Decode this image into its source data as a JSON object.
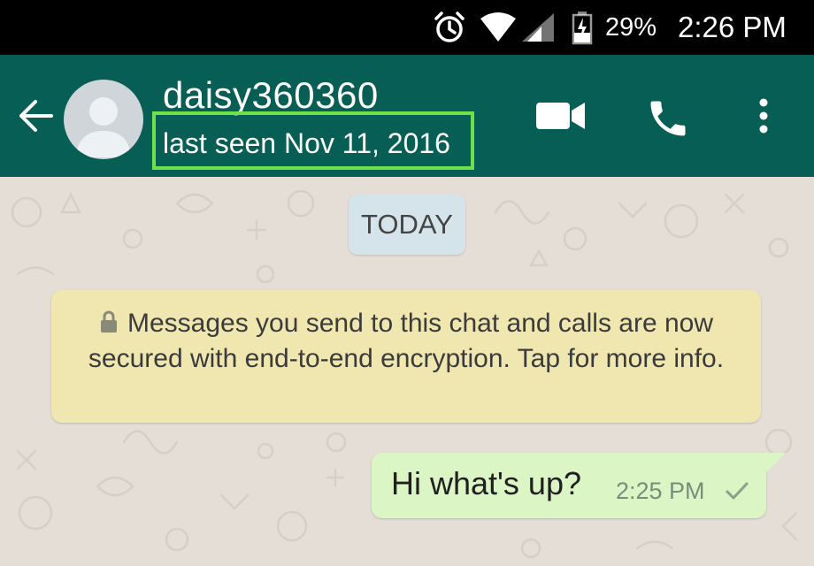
{
  "status_bar": {
    "battery_percent": "29%",
    "time": "2:26 PM",
    "icons": [
      "alarm-icon",
      "wifi-icon",
      "signal-icon",
      "battery-icon"
    ]
  },
  "header": {
    "contact_name": "daisy360360",
    "last_seen": "last seen Nov 11, 2016",
    "highlight_color": "#6ee04a",
    "background_color": "#075e54",
    "icons": [
      "back-arrow-icon",
      "avatar",
      "video-call-icon",
      "phone-icon",
      "more-options-icon"
    ]
  },
  "chat": {
    "date_label": "TODAY",
    "encryption_notice": "Messages you send to this chat and calls are now secured with end-to-end encryption. Tap for more info.",
    "messages": [
      {
        "text": "Hi what's up?",
        "time": "2:25 PM",
        "status": "sent"
      }
    ]
  }
}
